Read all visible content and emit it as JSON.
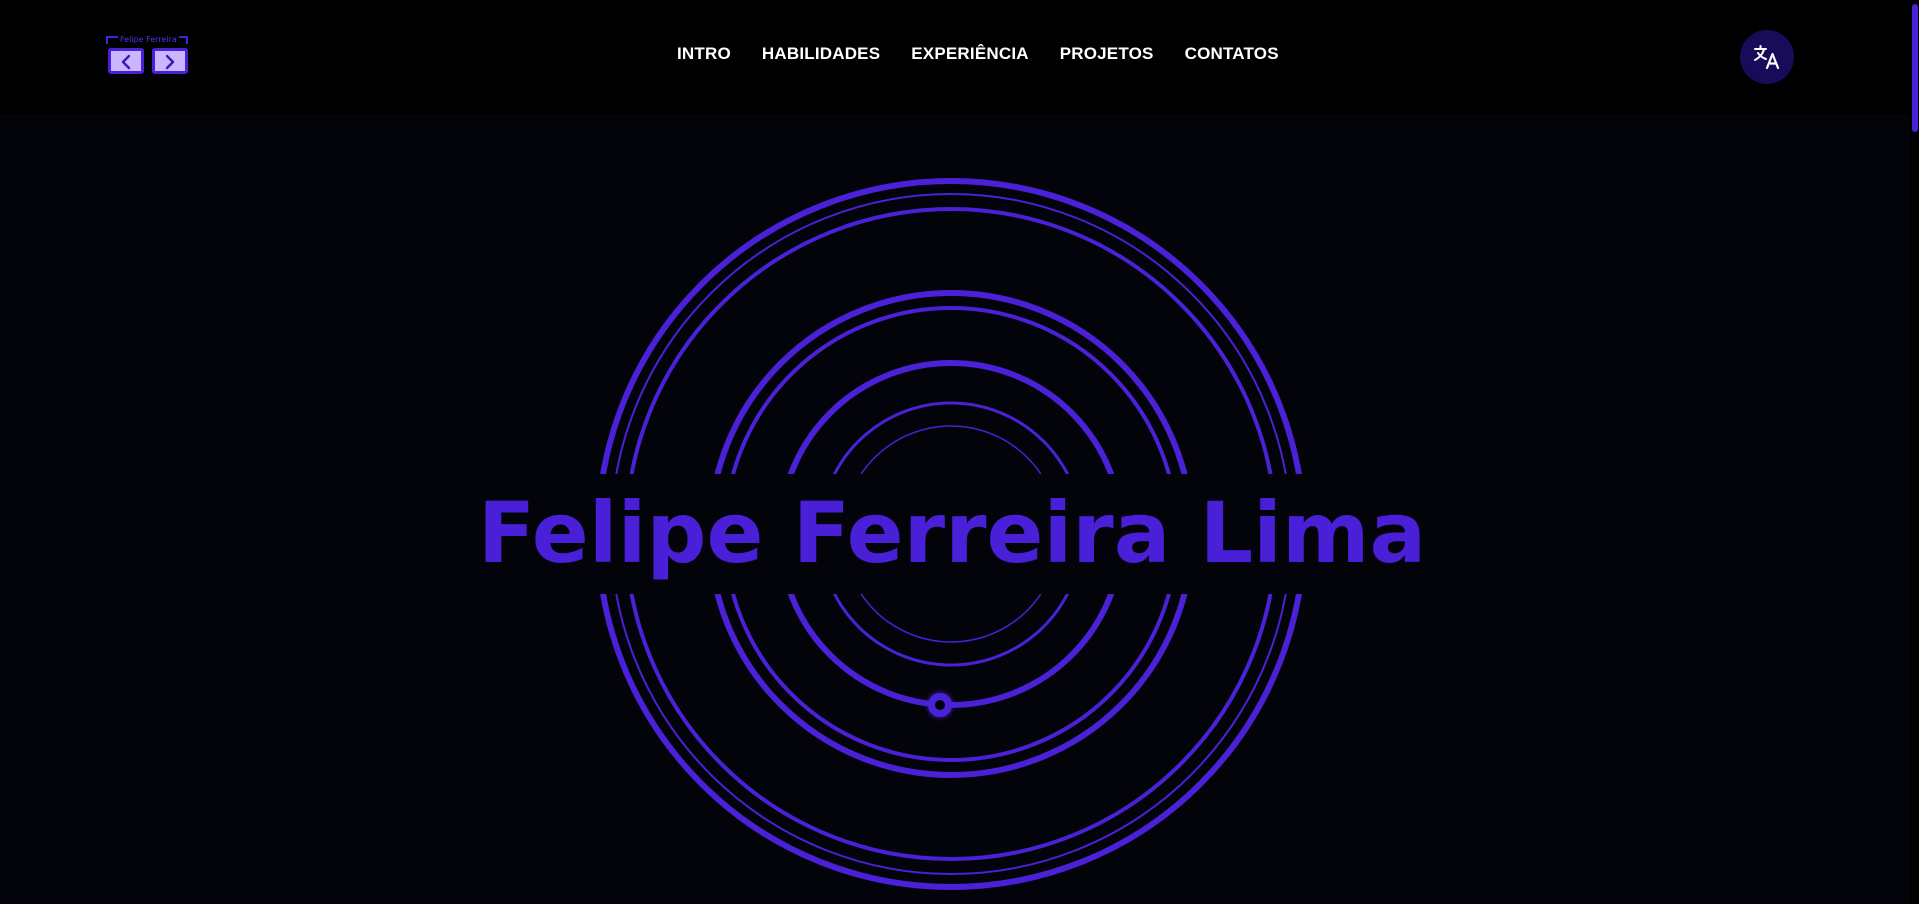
{
  "header": {
    "logo": {
      "text": "Felipe Ferreira",
      "prev_icon": "chevron-left-icon",
      "next_icon": "chevron-right-icon"
    },
    "nav": [
      {
        "label": "INTRO"
      },
      {
        "label": "HABILIDADES"
      },
      {
        "label": "EXPERIÊNCIA"
      },
      {
        "label": "PROJETOS"
      },
      {
        "label": "CONTATOS"
      }
    ],
    "language_icon": "translate-icon"
  },
  "hero": {
    "title": "Felipe Ferreira Lima"
  },
  "colors": {
    "accent": "#4a21d6",
    "background": "#03030a",
    "header_bg": "#000000",
    "text": "#ffffff",
    "logo_button_fill": "#c9b6ff",
    "language_button_bg": "#1a0b5a"
  }
}
